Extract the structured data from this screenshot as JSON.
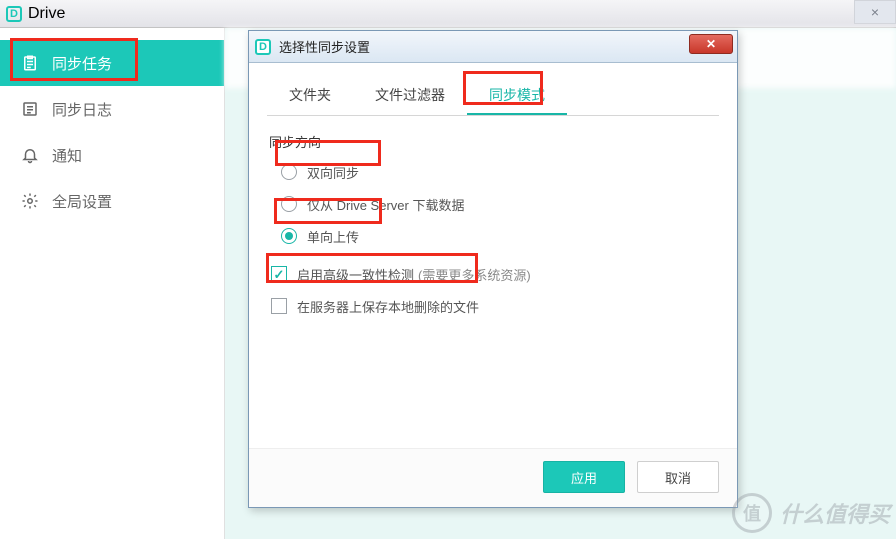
{
  "main": {
    "app_title": "Drive",
    "close_label": "×"
  },
  "sidebar": {
    "items": [
      {
        "label": "同步任务"
      },
      {
        "label": "同步日志"
      },
      {
        "label": "通知"
      },
      {
        "label": "全局设置"
      }
    ]
  },
  "dialog": {
    "title": "选择性同步设置",
    "close_label": "✕",
    "tabs": [
      {
        "label": "文件夹"
      },
      {
        "label": "文件过滤器"
      },
      {
        "label": "同步模式"
      }
    ],
    "active_tab_index": 2,
    "section_label": "同步方向",
    "radios": [
      {
        "label": "双向同步"
      },
      {
        "label": "仅从 Drive Server 下载数据"
      },
      {
        "label": "单向上传"
      }
    ],
    "selected_radio_index": 2,
    "check_consistency": {
      "label": "启用高级一致性检测",
      "hint": "(需要更多系统资源)",
      "checked": true
    },
    "check_keep_deleted": {
      "label": "在服务器上保存本地删除的文件",
      "checked": false
    },
    "buttons": {
      "apply": "应用",
      "cancel": "取消"
    }
  },
  "watermark": {
    "badge": "值",
    "text": "什么值得买"
  }
}
